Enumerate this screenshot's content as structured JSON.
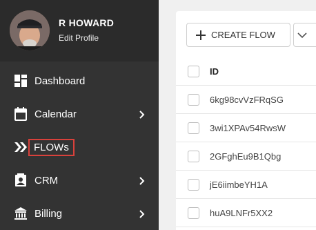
{
  "profile": {
    "name": "R HOWARD",
    "edit_label": "Edit Profile"
  },
  "nav": [
    {
      "label": "Dashboard",
      "icon": "dashboard-icon",
      "chevron": false
    },
    {
      "label": "Calendar",
      "icon": "calendar-icon",
      "chevron": true
    },
    {
      "label": "FLOWs",
      "icon": "double-chevron-icon",
      "chevron": false
    },
    {
      "label": "CRM",
      "icon": "contact-card-icon",
      "chevron": true
    },
    {
      "label": "Billing",
      "icon": "bank-icon",
      "chevron": true
    }
  ],
  "toolbar": {
    "create_label": "CREATE FLOW"
  },
  "table": {
    "header": "ID",
    "rows": [
      "6kg98cvVzFRqSG",
      "3wi1XPAv54RwsW",
      "2GFghEu9B1Qbg",
      "jE6iimbeYH1A",
      "huA9LNFr5XX2"
    ]
  },
  "colors": {
    "sidebar": "#333333",
    "highlight": "#d9413b",
    "background": "#f0f0f0"
  }
}
